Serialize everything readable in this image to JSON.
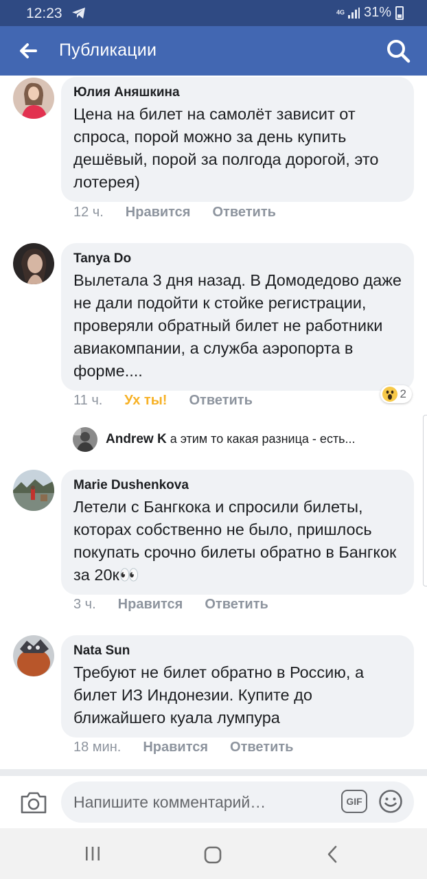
{
  "status_bar": {
    "time": "12:23",
    "network": "4G",
    "battery": "31%"
  },
  "header": {
    "title": "Публикации"
  },
  "comments": [
    {
      "author": "Юлия Аняшкина",
      "text": "Цена на билет на самолёт зависит от спроса, порой можно за день купить дешёвый, порой за полгода дорогой, это лотерея)",
      "time": "12 ч.",
      "like": "Нравится",
      "reply": "Ответить"
    },
    {
      "author": "Tanya Do",
      "text": "Вылетала 3 дня назад. В Домодедово даже не дали подойти к стойке регистрации, проверяли обратный билет не работники авиакомпании, а служба аэропорта в форме....",
      "time": "11 ч.",
      "like": "Ух ты!",
      "reply": "Ответить",
      "reaction_count": "2",
      "reply_preview": {
        "author": "Andrew K",
        "text": "а этим то какая разница - есть..."
      }
    },
    {
      "author": "Marie Dushenkova",
      "text": "Летели с Бангкока и спросили билеты, которах собственно не было, пришлось покупать срочно билеты обратно в Бангкок за 20к👀",
      "time": "3 ч.",
      "like": "Нравится",
      "reply": "Ответить"
    },
    {
      "author": "Nata Sun",
      "text": "Требуют не билет обратно в Россию, а билет ИЗ Индонезии. Купите до ближайшего куала лумпура",
      "time": "18 мин.",
      "like": "Нравится",
      "reply": "Ответить"
    }
  ],
  "composer": {
    "placeholder": "Напишите комментарий…",
    "gif_label": "GIF"
  },
  "icons": {
    "back": "arrow-left-icon",
    "search": "search-icon",
    "camera": "camera-icon",
    "emoji": "smiley-icon",
    "wow": "wow-reaction-icon",
    "nav_recents": "recents-icon",
    "nav_home": "home-icon",
    "nav_back": "chevron-left-icon"
  },
  "colors": {
    "header": "#4267b2",
    "status_bar": "#2f4a83",
    "bubble": "#f0f2f5",
    "meta": "#8d949e",
    "wow": "#f7b125"
  }
}
